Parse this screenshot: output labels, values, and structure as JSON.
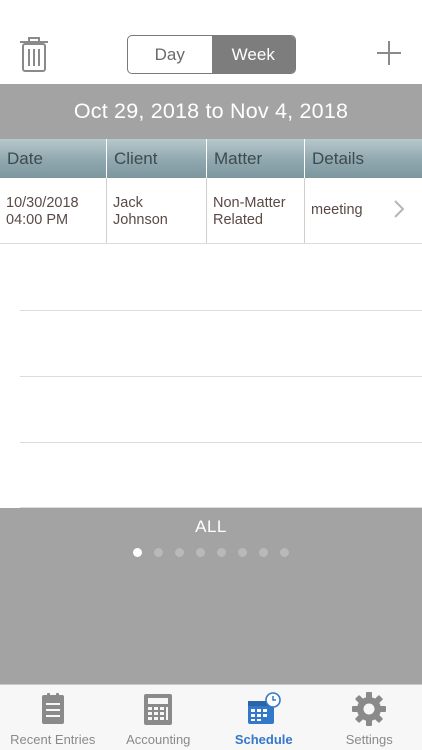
{
  "toolbar": {
    "segments": [
      {
        "label": "Day",
        "active": false
      },
      {
        "label": "Week",
        "active": true
      }
    ]
  },
  "date_range": "Oct 29, 2018 to Nov 4, 2018",
  "table": {
    "columns": [
      "Date",
      "Client",
      "Matter",
      "Details"
    ],
    "rows": [
      {
        "date_line1": "10/30/2018",
        "date_line2": "04:00 PM",
        "client_line1": "Jack",
        "client_line2": "Johnson",
        "matter_line1": "Non-Matter",
        "matter_line2": "Related",
        "details": "meeting"
      }
    ]
  },
  "filter": {
    "label": "ALL",
    "page_count": 8,
    "active_page": 0
  },
  "tabbar": {
    "tabs": [
      {
        "label": "Recent Entries",
        "icon": "list-icon",
        "active": false
      },
      {
        "label": "Accounting",
        "icon": "calculator-icon",
        "active": false
      },
      {
        "label": "Schedule",
        "icon": "calendar-clock-icon",
        "active": true
      },
      {
        "label": "Settings",
        "icon": "gear-icon",
        "active": false
      }
    ]
  },
  "colors": {
    "header_gray": "#a3a3a3",
    "segment_active": "#7d7d7d",
    "table_header": "#8fa7ae",
    "accent_blue": "#3478c9",
    "inactive_icon": "#8a8a8a"
  }
}
